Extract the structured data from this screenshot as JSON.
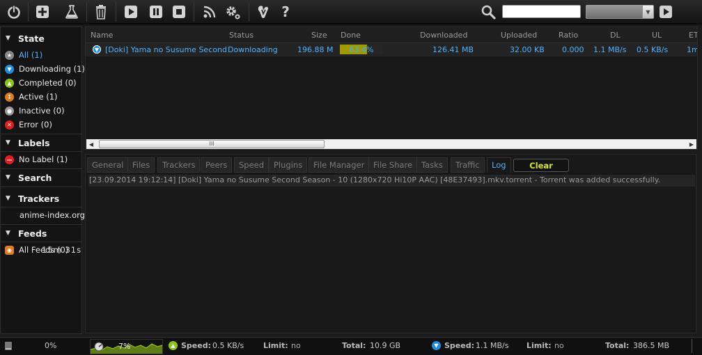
{
  "toolbar": {
    "search_placeholder": "",
    "search_engine": ""
  },
  "sidebar": {
    "categories": {
      "state": "State",
      "labels": "Labels",
      "search": "Search",
      "trackers": "Trackers",
      "feeds": "Feeds"
    },
    "state_items": [
      {
        "label": "All (1)",
        "color": "#888888"
      },
      {
        "label": "Downloading (1)",
        "color": "#1e8de0"
      },
      {
        "label": "Completed (0)",
        "color": "#8ac619"
      },
      {
        "label": "Active (1)",
        "color": "#e07a1e"
      },
      {
        "label": "Inactive (0)",
        "color": "#9a9a9a"
      },
      {
        "label": "Error (0)",
        "color": "#e02020"
      }
    ],
    "label_items": [
      {
        "label": "No Label (1)"
      }
    ],
    "tracker_items": [
      {
        "label": "anime-index.org"
      }
    ],
    "feed_items": [
      {
        "label": "All Feeds (0)",
        "overlay": "15m 31s"
      }
    ]
  },
  "list": {
    "columns": [
      "Name",
      "Status",
      "Size",
      "Done",
      "Downloaded",
      "Uploaded",
      "Ratio",
      "DL",
      "UL",
      "ET"
    ],
    "rows": [
      {
        "name": "[Doki] Yama no Susume Second",
        "status": "Downloading",
        "size": "196.88 M",
        "done": "63.4%",
        "progress": 0.634,
        "downloaded": "126.41 MB",
        "uploaded": "32.00 KB",
        "ratio": "0.000",
        "dl": "1.1 MB/s",
        "ul": "0.5 KB/s",
        "et": "1m"
      }
    ],
    "scroll_grip": "III"
  },
  "details": {
    "tabs": [
      "General",
      "Files",
      "Trackers",
      "Peers",
      "Speed",
      "Plugins",
      "File Manager",
      "File Share",
      "Tasks",
      "Traffic",
      "Log"
    ],
    "active_tab": "Log",
    "clear_label": "Clear",
    "log_line": "[23.09.2014 19:12:14] [Doki] Yama no Susume Second Season - 10 (1280x720 Hi10P AAC) [48E37493].mkv.torrent - Torrent was added successfully."
  },
  "statusbar": {
    "disk_pct": "0%",
    "cpu_pct": "7%",
    "up_speed_label": "Speed:",
    "up_speed": "0.5 KB/s",
    "up_limit_label": "Limit:",
    "up_limit": "no",
    "up_total_label": "Total:",
    "up_total": "10.9 GB",
    "dl_speed_label": "Speed:",
    "dl_speed": "1.1 MB/s",
    "dl_limit_label": "Limit:",
    "dl_limit": "no",
    "dl_total_label": "Total:",
    "dl_total": "386.5 MB"
  }
}
